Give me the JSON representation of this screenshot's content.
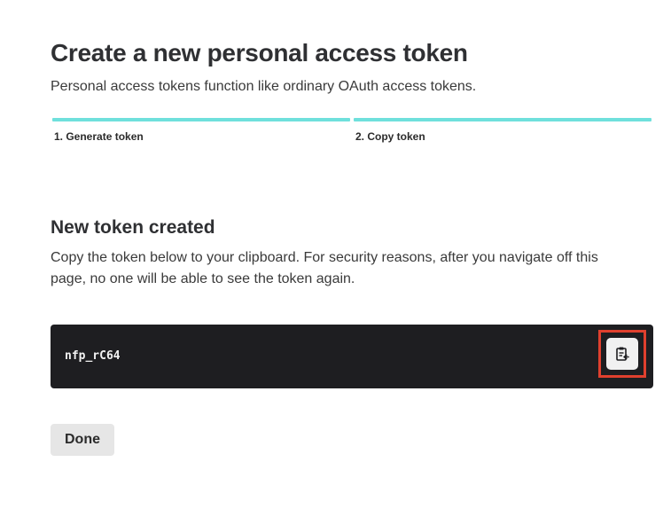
{
  "header": {
    "title": "Create a new personal access token",
    "subtitle": "Personal access tokens function like ordinary OAuth access tokens."
  },
  "steps": [
    {
      "label": "1. Generate token"
    },
    {
      "label": "2. Copy token"
    }
  ],
  "token_section": {
    "title": "New token created",
    "description": "Copy the token below to your clipboard. For security reasons, after you navigate off this page, no one will be able to see the token again.",
    "token_value": "nfp_rC64",
    "copy_icon": "clipboard-copy-icon"
  },
  "actions": {
    "done_label": "Done"
  },
  "colors": {
    "step_accent": "#6fe0dc",
    "token_background": "#1e1e21",
    "highlight": "#e0402e"
  }
}
